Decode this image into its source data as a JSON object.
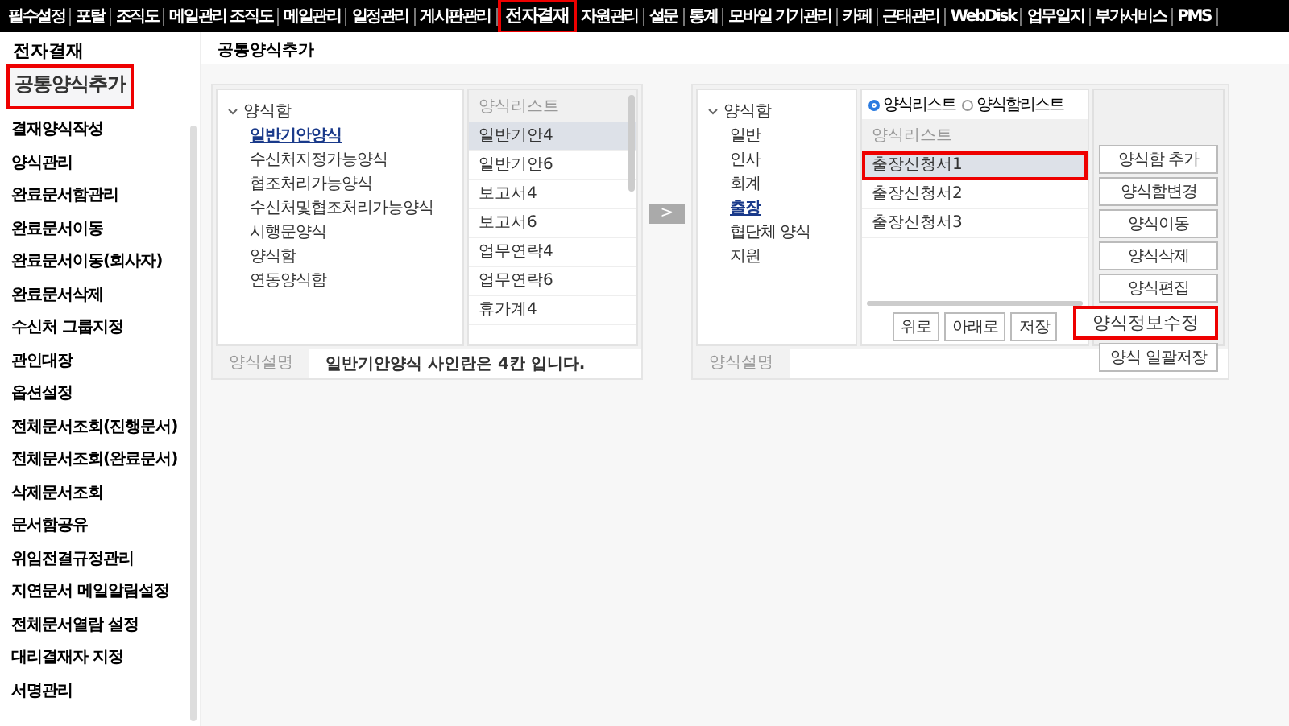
{
  "top_nav": [
    {
      "label": "필수설정",
      "selected": false
    },
    {
      "label": "포탈",
      "selected": false
    },
    {
      "label": "조직도",
      "selected": false
    },
    {
      "label": "메일관리 조직도",
      "selected": false
    },
    {
      "label": "메일관리",
      "selected": false
    },
    {
      "label": "일정관리",
      "selected": false
    },
    {
      "label": "게시판관리",
      "selected": false
    },
    {
      "label": "전자결재",
      "selected": true
    },
    {
      "label": "자원관리",
      "selected": false
    },
    {
      "label": "설문",
      "selected": false
    },
    {
      "label": "통계",
      "selected": false
    },
    {
      "label": "모바일 기기관리",
      "selected": false
    },
    {
      "label": "카페",
      "selected": false
    },
    {
      "label": "근태관리",
      "selected": false
    },
    {
      "label": "WebDisk",
      "selected": false
    },
    {
      "label": "업무일지",
      "selected": false
    },
    {
      "label": "부가서비스",
      "selected": false
    },
    {
      "label": "PMS",
      "selected": false
    }
  ],
  "sidebar": {
    "title": "전자결재",
    "items": [
      {
        "label": "공통양식추가",
        "selected": true
      },
      {
        "label": "결재양식작성",
        "selected": false
      },
      {
        "label": "양식관리",
        "selected": false
      },
      {
        "label": "완료문서함관리",
        "selected": false
      },
      {
        "label": "완료문서이동",
        "selected": false
      },
      {
        "label": "완료문서이동(회사자)",
        "selected": false
      },
      {
        "label": "완료문서삭제",
        "selected": false
      },
      {
        "label": "수신처 그룹지정",
        "selected": false
      },
      {
        "label": "관인대장",
        "selected": false
      },
      {
        "label": "옵션설정",
        "selected": false
      },
      {
        "label": "전체문서조회(진행문서)",
        "selected": false
      },
      {
        "label": "전체문서조회(완료문서)",
        "selected": false
      },
      {
        "label": "삭제문서조회",
        "selected": false
      },
      {
        "label": "문서함공유",
        "selected": false
      },
      {
        "label": "위임전결규정관리",
        "selected": false
      },
      {
        "label": "지연문서 메일알림설정",
        "selected": false
      },
      {
        "label": "전체문서열람 설정",
        "selected": false
      },
      {
        "label": "대리결재자 지정",
        "selected": false
      },
      {
        "label": "서명관리",
        "selected": false
      }
    ]
  },
  "page_title": "공통양식추가",
  "source_panel": {
    "tree": {
      "label": "양식함",
      "expanded": true,
      "children": [
        {
          "label": "일반기안양식",
          "selected": true
        },
        {
          "label": "수신처지정가능양식",
          "selected": false
        },
        {
          "label": "협조처리가능양식",
          "selected": false
        },
        {
          "label": "수신처및협조처리가능양식",
          "selected": false
        },
        {
          "label": "시행문양식",
          "selected": false
        },
        {
          "label": "양식함",
          "selected": false
        },
        {
          "label": "연동양식함",
          "selected": false
        }
      ]
    },
    "list_header": "양식리스트",
    "list": [
      {
        "label": "일반기안4",
        "selected": true
      },
      {
        "label": "일반기안6",
        "selected": false
      },
      {
        "label": "보고서4",
        "selected": false
      },
      {
        "label": "보고서6",
        "selected": false
      },
      {
        "label": "업무연락4",
        "selected": false
      },
      {
        "label": "업무연락6",
        "selected": false
      },
      {
        "label": "휴가계4",
        "selected": false
      }
    ],
    "description_label": "양식설명",
    "description": "일반기안양식 사인란은 4칸 입니다."
  },
  "move_button": ">",
  "target_panel": {
    "tree": {
      "label": "양식함",
      "expanded": true,
      "children": [
        {
          "label": "일반",
          "selected": false
        },
        {
          "label": "인사",
          "selected": false
        },
        {
          "label": "회계",
          "selected": false
        },
        {
          "label": "출장",
          "selected": true
        },
        {
          "label": "협단체 양식",
          "selected": false
        },
        {
          "label": "지원",
          "selected": false
        }
      ]
    },
    "radios": [
      {
        "label": "양식리스트",
        "selected": true
      },
      {
        "label": "양식함리스트",
        "selected": false
      }
    ],
    "list_header": "양식리스트",
    "list": [
      {
        "label": "출장신청서1",
        "selected": true
      },
      {
        "label": "출장신청서2",
        "selected": false
      },
      {
        "label": "출장신청서3",
        "selected": false
      }
    ],
    "list_buttons": [
      "위로",
      "아래로",
      "저장"
    ],
    "side_buttons": [
      {
        "kind": "button",
        "label": "양식함 추가"
      },
      {
        "kind": "button",
        "label": "양식함변경"
      },
      {
        "kind": "button",
        "label": "양식이동"
      },
      {
        "kind": "button",
        "label": "양식삭제"
      },
      {
        "kind": "button",
        "label": "양식편집"
      },
      {
        "kind": "popup",
        "label": "양식정보수정"
      },
      {
        "kind": "button",
        "label": "양식 일괄저장"
      }
    ],
    "description_label": "양식설명"
  }
}
